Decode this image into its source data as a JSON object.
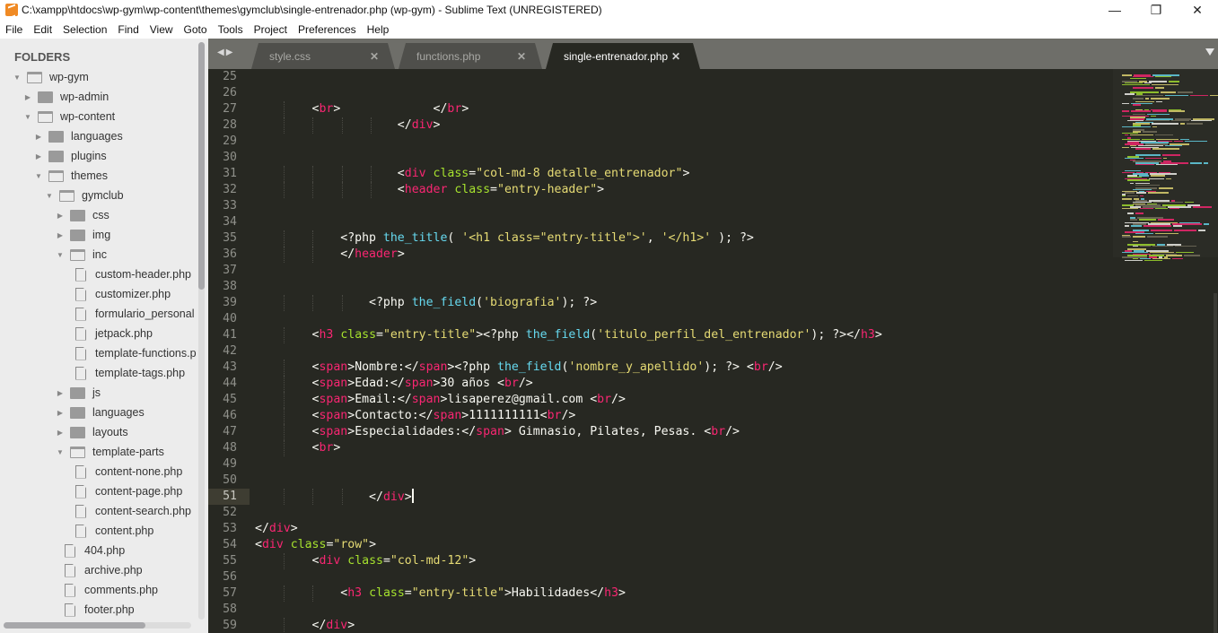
{
  "window": {
    "title": "C:\\xampp\\htdocs\\wp-gym\\wp-content\\themes\\gymclub\\single-entrenador.php (wp-gym) - Sublime Text (UNREGISTERED)",
    "app_icon": "sublime-text-icon",
    "controls": {
      "minimize": "—",
      "maximize": "❐",
      "close": "✕"
    }
  },
  "menu": [
    "File",
    "Edit",
    "Selection",
    "Find",
    "View",
    "Goto",
    "Tools",
    "Project",
    "Preferences",
    "Help"
  ],
  "sidebar": {
    "header": "FOLDERS",
    "tree": [
      {
        "label": "wp-gym",
        "type": "folder",
        "open": true,
        "depth": 0
      },
      {
        "label": "wp-admin",
        "type": "folder",
        "open": false,
        "depth": 1
      },
      {
        "label": "wp-content",
        "type": "folder",
        "open": true,
        "depth": 1
      },
      {
        "label": "languages",
        "type": "folder",
        "open": false,
        "depth": 2
      },
      {
        "label": "plugins",
        "type": "folder",
        "open": false,
        "depth": 2
      },
      {
        "label": "themes",
        "type": "folder",
        "open": true,
        "depth": 2
      },
      {
        "label": "gymclub",
        "type": "folder",
        "open": true,
        "depth": 3
      },
      {
        "label": "css",
        "type": "folder",
        "open": false,
        "depth": 4
      },
      {
        "label": "img",
        "type": "folder",
        "open": false,
        "depth": 4
      },
      {
        "label": "inc",
        "type": "folder",
        "open": true,
        "depth": 4
      },
      {
        "label": "custom-header.php",
        "type": "file",
        "depth": 5
      },
      {
        "label": "customizer.php",
        "type": "file",
        "depth": 5
      },
      {
        "label": "formulario_personal",
        "type": "file",
        "depth": 5
      },
      {
        "label": "jetpack.php",
        "type": "file",
        "depth": 5
      },
      {
        "label": "template-functions.p",
        "type": "file",
        "depth": 5
      },
      {
        "label": "template-tags.php",
        "type": "file",
        "depth": 5
      },
      {
        "label": "js",
        "type": "folder",
        "open": false,
        "depth": 4
      },
      {
        "label": "languages",
        "type": "folder",
        "open": false,
        "depth": 4
      },
      {
        "label": "layouts",
        "type": "folder",
        "open": false,
        "depth": 4
      },
      {
        "label": "template-parts",
        "type": "folder",
        "open": true,
        "depth": 4
      },
      {
        "label": "content-none.php",
        "type": "file",
        "depth": 5
      },
      {
        "label": "content-page.php",
        "type": "file",
        "depth": 5
      },
      {
        "label": "content-search.php",
        "type": "file",
        "depth": 5
      },
      {
        "label": "content.php",
        "type": "file",
        "depth": 5
      },
      {
        "label": "404.php",
        "type": "file",
        "depth": 4
      },
      {
        "label": "archive.php",
        "type": "file",
        "depth": 4
      },
      {
        "label": "comments.php",
        "type": "file",
        "depth": 4
      },
      {
        "label": "footer.php",
        "type": "file",
        "depth": 4
      }
    ]
  },
  "tabs": [
    {
      "label": "style.css",
      "active": false
    },
    {
      "label": "functions.php",
      "active": false
    },
    {
      "label": "single-entrenador.php",
      "active": true
    }
  ],
  "editor": {
    "current_line": 51,
    "colors": {
      "background": "#272822",
      "tag": "#f92672",
      "attr": "#a6e22e",
      "string": "#e6db74",
      "function": "#66d9ef",
      "text": "#f8f8f2"
    },
    "lines": [
      {
        "n": 25,
        "indent": 0,
        "tokens": []
      },
      {
        "n": 26,
        "indent": 0,
        "tokens": []
      },
      {
        "n": 27,
        "indent": 8,
        "tokens": [
          [
            "p",
            "<"
          ],
          [
            "t",
            "br"
          ],
          [
            "p",
            ">             </"
          ],
          [
            "t",
            "br"
          ],
          [
            "p",
            ">"
          ]
        ]
      },
      {
        "n": 28,
        "indent": 20,
        "tokens": [
          [
            "p",
            "</"
          ],
          [
            "t",
            "div"
          ],
          [
            "p",
            ">"
          ]
        ]
      },
      {
        "n": 29,
        "indent": 0,
        "tokens": []
      },
      {
        "n": 30,
        "indent": 0,
        "tokens": []
      },
      {
        "n": 31,
        "indent": 20,
        "tokens": [
          [
            "p",
            "<"
          ],
          [
            "t",
            "div"
          ],
          [
            "p",
            " "
          ],
          [
            "a",
            "class"
          ],
          [
            "p",
            "="
          ],
          [
            "s",
            "\"col-md-8 detalle_entrenador\""
          ],
          [
            "p",
            ">"
          ]
        ]
      },
      {
        "n": 32,
        "indent": 20,
        "tokens": [
          [
            "p",
            "<"
          ],
          [
            "t",
            "header"
          ],
          [
            "p",
            " "
          ],
          [
            "a",
            "class"
          ],
          [
            "p",
            "="
          ],
          [
            "s",
            "\"entry-header\""
          ],
          [
            "p",
            ">"
          ]
        ]
      },
      {
        "n": 33,
        "indent": 0,
        "tokens": []
      },
      {
        "n": 34,
        "indent": 0,
        "tokens": []
      },
      {
        "n": 35,
        "indent": 12,
        "tokens": [
          [
            "p",
            "<?php "
          ],
          [
            "f",
            "the_title"
          ],
          [
            "p",
            "( "
          ],
          [
            "s",
            "'<h1 class=\"entry-title\">'"
          ],
          [
            "p",
            ", "
          ],
          [
            "s",
            "'</h1>'"
          ],
          [
            "p",
            " ); ?>"
          ]
        ]
      },
      {
        "n": 36,
        "indent": 12,
        "tokens": [
          [
            "p",
            "</"
          ],
          [
            "t",
            "header"
          ],
          [
            "p",
            ">"
          ]
        ]
      },
      {
        "n": 37,
        "indent": 0,
        "tokens": []
      },
      {
        "n": 38,
        "indent": 0,
        "tokens": []
      },
      {
        "n": 39,
        "indent": 16,
        "tokens": [
          [
            "p",
            "<?php "
          ],
          [
            "f",
            "the_field"
          ],
          [
            "p",
            "("
          ],
          [
            "s",
            "'biografia'"
          ],
          [
            "p",
            "); ?>"
          ]
        ]
      },
      {
        "n": 40,
        "indent": 0,
        "tokens": []
      },
      {
        "n": 41,
        "indent": 8,
        "tokens": [
          [
            "p",
            "<"
          ],
          [
            "t",
            "h3"
          ],
          [
            "p",
            " "
          ],
          [
            "a",
            "class"
          ],
          [
            "p",
            "="
          ],
          [
            "s",
            "\"entry-title\""
          ],
          [
            "p",
            ">"
          ],
          [
            "p",
            "<?php "
          ],
          [
            "f",
            "the_field"
          ],
          [
            "p",
            "("
          ],
          [
            "s",
            "'titulo_perfil_del_entrenador'"
          ],
          [
            "p",
            "); ?></"
          ],
          [
            "t",
            "h3"
          ],
          [
            "p",
            ">"
          ]
        ]
      },
      {
        "n": 42,
        "indent": 0,
        "tokens": []
      },
      {
        "n": 43,
        "indent": 8,
        "tokens": [
          [
            "p",
            "<"
          ],
          [
            "t",
            "span"
          ],
          [
            "p",
            ">Nombre:</"
          ],
          [
            "t",
            "span"
          ],
          [
            "p",
            ">"
          ],
          [
            "p",
            "<?php "
          ],
          [
            "f",
            "the_field"
          ],
          [
            "p",
            "("
          ],
          [
            "s",
            "'nombre_y_apellido'"
          ],
          [
            "p",
            "); ?> <"
          ],
          [
            "t",
            "br"
          ],
          [
            "p",
            "/>"
          ]
        ]
      },
      {
        "n": 44,
        "indent": 8,
        "tokens": [
          [
            "p",
            "<"
          ],
          [
            "t",
            "span"
          ],
          [
            "p",
            ">Edad:</"
          ],
          [
            "t",
            "span"
          ],
          [
            "p",
            ">30 años <"
          ],
          [
            "t",
            "br"
          ],
          [
            "p",
            "/>"
          ]
        ]
      },
      {
        "n": 45,
        "indent": 8,
        "tokens": [
          [
            "p",
            "<"
          ],
          [
            "t",
            "span"
          ],
          [
            "p",
            ">Email:</"
          ],
          [
            "t",
            "span"
          ],
          [
            "p",
            ">lisaperez@gmail.com <"
          ],
          [
            "t",
            "br"
          ],
          [
            "p",
            "/>"
          ]
        ]
      },
      {
        "n": 46,
        "indent": 8,
        "tokens": [
          [
            "p",
            "<"
          ],
          [
            "t",
            "span"
          ],
          [
            "p",
            ">Contacto:</"
          ],
          [
            "t",
            "span"
          ],
          [
            "p",
            ">1111111111<"
          ],
          [
            "t",
            "br"
          ],
          [
            "p",
            "/>"
          ]
        ]
      },
      {
        "n": 47,
        "indent": 8,
        "tokens": [
          [
            "p",
            "<"
          ],
          [
            "t",
            "span"
          ],
          [
            "p",
            ">Especialidades:</"
          ],
          [
            "t",
            "span"
          ],
          [
            "p",
            "> Gimnasio, Pilates, Pesas. <"
          ],
          [
            "t",
            "br"
          ],
          [
            "p",
            "/>"
          ]
        ]
      },
      {
        "n": 48,
        "indent": 8,
        "tokens": [
          [
            "p",
            "<"
          ],
          [
            "t",
            "br"
          ],
          [
            "p",
            ">"
          ]
        ]
      },
      {
        "n": 49,
        "indent": 0,
        "tokens": []
      },
      {
        "n": 50,
        "indent": 0,
        "tokens": []
      },
      {
        "n": 51,
        "indent": 16,
        "tokens": [
          [
            "p",
            "</"
          ],
          [
            "t",
            "div"
          ],
          [
            "p",
            ">"
          ]
        ],
        "cursor": true
      },
      {
        "n": 52,
        "indent": 0,
        "tokens": []
      },
      {
        "n": 53,
        "indent": 0,
        "tokens": [
          [
            "p",
            "</"
          ],
          [
            "t",
            "div"
          ],
          [
            "p",
            ">"
          ]
        ]
      },
      {
        "n": 54,
        "indent": 0,
        "tokens": [
          [
            "p",
            "<"
          ],
          [
            "t",
            "div"
          ],
          [
            "p",
            " "
          ],
          [
            "a",
            "class"
          ],
          [
            "p",
            "="
          ],
          [
            "s",
            "\"row\""
          ],
          [
            "p",
            ">"
          ]
        ]
      },
      {
        "n": 55,
        "indent": 8,
        "tokens": [
          [
            "p",
            "<"
          ],
          [
            "t",
            "div"
          ],
          [
            "p",
            " "
          ],
          [
            "a",
            "class"
          ],
          [
            "p",
            "="
          ],
          [
            "s",
            "\"col-md-12\""
          ],
          [
            "p",
            ">"
          ]
        ]
      },
      {
        "n": 56,
        "indent": 0,
        "tokens": []
      },
      {
        "n": 57,
        "indent": 12,
        "tokens": [
          [
            "p",
            "<"
          ],
          [
            "t",
            "h3"
          ],
          [
            "p",
            " "
          ],
          [
            "a",
            "class"
          ],
          [
            "p",
            "="
          ],
          [
            "s",
            "\"entry-title\""
          ],
          [
            "p",
            ">Habilidades</"
          ],
          [
            "t",
            "h3"
          ],
          [
            "p",
            ">"
          ]
        ]
      },
      {
        "n": 58,
        "indent": 0,
        "tokens": []
      },
      {
        "n": 59,
        "indent": 8,
        "tokens": [
          [
            "p",
            "</"
          ],
          [
            "t",
            "div"
          ],
          [
            "p",
            ">"
          ]
        ]
      }
    ]
  }
}
